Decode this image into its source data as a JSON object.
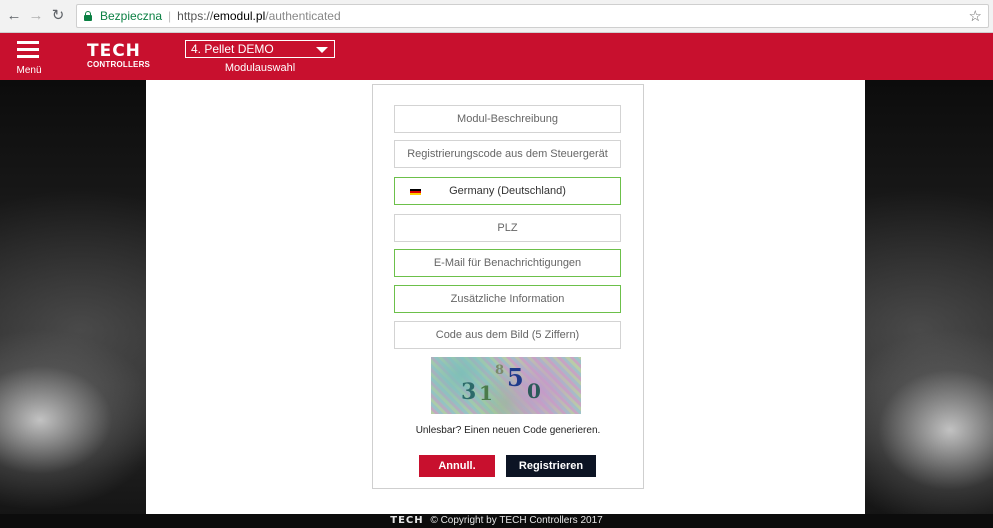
{
  "browser": {
    "secure_label": "Bezpieczna",
    "url_scheme": "https://",
    "url_host": "emodul.pl",
    "url_path": "/authenticated"
  },
  "header": {
    "menu_label": "Menü",
    "logo_main": "TECH",
    "logo_sub": "CONTROLLERS",
    "module_value": "4. Pellet DEMO",
    "module_caption": "Modulauswahl",
    "color": "#c8102e"
  },
  "form": {
    "description_placeholder": "Modul-Beschreibung",
    "code_placeholder": "Registrierungscode aus dem Steuergerät",
    "country_value": "Germany (Deutschland)",
    "zip_placeholder": "PLZ",
    "email_placeholder": "E-Mail für Benachrichtigungen",
    "info_placeholder": "Zusätzliche Information",
    "captcha_placeholder": "Code aus dem Bild (5 Ziffern)",
    "captcha_chars": [
      "3",
      "1",
      "8",
      "5",
      "0"
    ],
    "regenerate_text": "Unlesbar? Einen neuen Code generieren.",
    "cancel_label": "Annull.",
    "register_label": "Registrieren"
  },
  "footer": {
    "logo": "TECH",
    "copyright": "© Copyright by TECH Controllers 2017"
  }
}
